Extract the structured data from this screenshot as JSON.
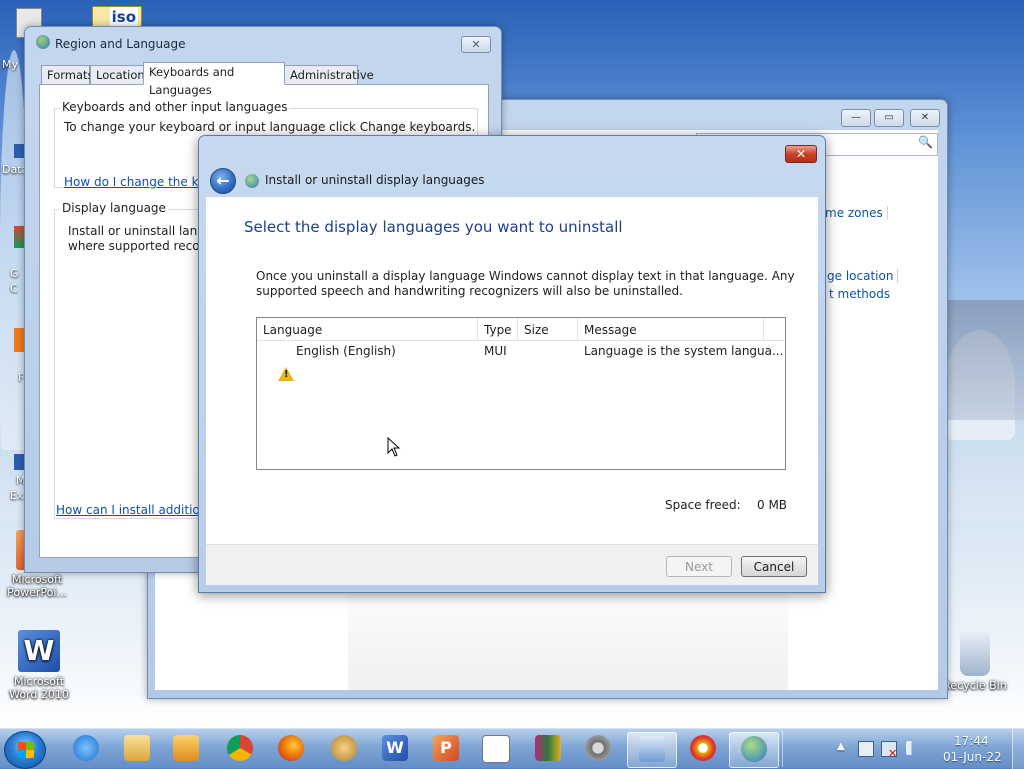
{
  "desktop": {
    "icons": [
      {
        "line1": "My",
        "line2": ""
      },
      {
        "line1": "Data",
        "line2": ""
      },
      {
        "line1": "G",
        "line2": "C"
      },
      {
        "line1": "F",
        "line2": ""
      },
      {
        "line1": "M",
        "line2": "Ex"
      },
      {
        "line1": "Microsoft",
        "line2": "PowerPoi..."
      },
      {
        "line1": "Microsoft",
        "line2": "Word 2010"
      },
      {
        "line1": "Recycle Bin",
        "line2": ""
      }
    ],
    "iso_label": "iso"
  },
  "region_window": {
    "title": "Region and Language",
    "close_glyph": "✕",
    "tabs": [
      "Formats",
      "Location",
      "Keyboards and Languages",
      "Administrative"
    ],
    "active_tab": "Keyboards and Languages",
    "keyboards_group": {
      "title": "Keyboards and other input languages",
      "text": "To change your keyboard or input language click Change keyboards.",
      "link": "How do I change the keyb"
    },
    "display_group": {
      "title": "Display language",
      "text_line1": "Install or uninstall langua",
      "text_line2": "where supported recogni"
    },
    "bottom_link": "How can I install additional"
  },
  "middle_window": {
    "links": [
      "me zones",
      "ge location",
      "t methods"
    ],
    "search_icon": "🔍",
    "controls": {
      "minimize": "—",
      "maximize": "▭",
      "close": "✕"
    }
  },
  "dialog": {
    "title": "Install or uninstall display languages",
    "back_glyph": "←",
    "close_glyph": "✕",
    "heading": "Select the display languages you want to uninstall",
    "description": "Once you uninstall a display language Windows cannot display text in that language. Any supported speech and handwriting recognizers will also be uninstalled.",
    "columns": [
      "Language",
      "Type",
      "Size",
      "Message"
    ],
    "rows": [
      {
        "language": "English (English)",
        "type": "MUI",
        "size": "",
        "message": "Language is the system langua..."
      }
    ],
    "space_freed_label": "Space freed:",
    "space_freed_value": "0 MB",
    "next_button": "Next",
    "cancel_button": "Cancel"
  },
  "taskbar": {
    "time": "17:44",
    "date": "01-Jun-22",
    "pinned": [
      "internet-explorer",
      "file-explorer",
      "media-player",
      "chrome",
      "firefox",
      "paint",
      "word",
      "powerpoint",
      "solitaire",
      "winrar",
      "settings",
      "control-panel",
      "security",
      "region-language"
    ],
    "tray_arrow": "▲"
  },
  "colors": {
    "link": "#0b53a8",
    "heading": "#1c3f8e",
    "warning": "#e8b714",
    "close_red": "#c7442c"
  }
}
